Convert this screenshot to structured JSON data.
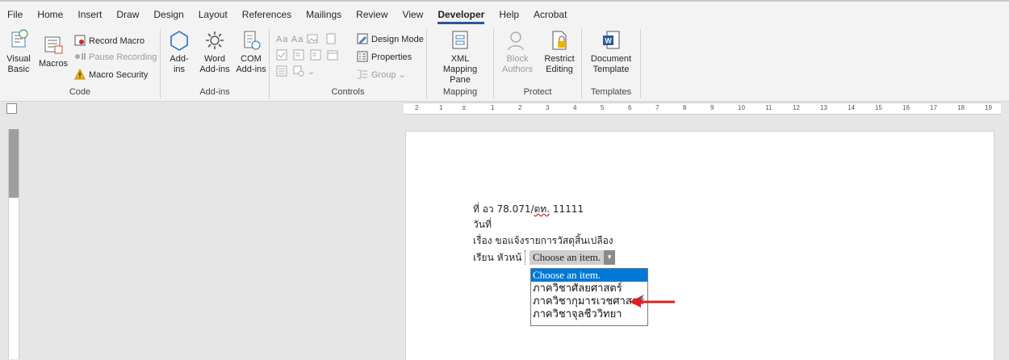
{
  "ribbon": {
    "tabs": [
      "File",
      "Home",
      "Insert",
      "Draw",
      "Design",
      "Layout",
      "References",
      "Mailings",
      "Review",
      "View",
      "Developer",
      "Help",
      "Acrobat"
    ],
    "active_tab": "Developer",
    "groups": {
      "code": {
        "label": "Code",
        "visual_basic": "Visual Basic",
        "macros": "Macros",
        "record_macro": "Record Macro",
        "pause_recording": "Pause Recording",
        "macro_security": "Macro Security"
      },
      "addins": {
        "label": "Add-ins",
        "addins": "Add-ins",
        "word_addins": "Word Add-ins",
        "com_addins": "COM Add-ins"
      },
      "controls": {
        "label": "Controls",
        "design_mode": "Design Mode",
        "properties": "Properties",
        "group": "Group"
      },
      "mapping": {
        "label": "Mapping",
        "xml_mapping_pane": "XML Mapping Pane"
      },
      "protect": {
        "label": "Protect",
        "block_authors": "Block Authors",
        "restrict_editing": "Restrict Editing"
      },
      "templates": {
        "label": "Templates",
        "document_template": "Document Template"
      }
    }
  },
  "ruler": {
    "marks": [
      "2",
      "1",
      "1",
      "2",
      "3",
      "4",
      "5",
      "6",
      "7",
      "8",
      "9",
      "10",
      "11",
      "12",
      "13",
      "14",
      "15",
      "16",
      "17",
      "18",
      "19"
    ]
  },
  "document": {
    "line1_prefix": "ที่ อว 78.071/",
    "line1_squiggle": "ตท.",
    "line1_suffix": " 11111",
    "line2": "วันที่",
    "line3": "เรื่อง   ขอแจ้งรายการวัสดุสิ้นเปลือง",
    "line4": "เรียน   หัวหน้",
    "content_control": "Choose an item."
  },
  "dropdown": {
    "options": [
      "Choose an item.",
      "ภาควิชาศัลยศาสตร์",
      "ภาควิชากุมารเวชศาสตร์",
      "ภาควิชาจุลชีววิทยา"
    ],
    "selected_index": 0
  },
  "colors": {
    "accent": "#2b579a",
    "selection": "#0078d7",
    "arrow": "#e02020"
  }
}
